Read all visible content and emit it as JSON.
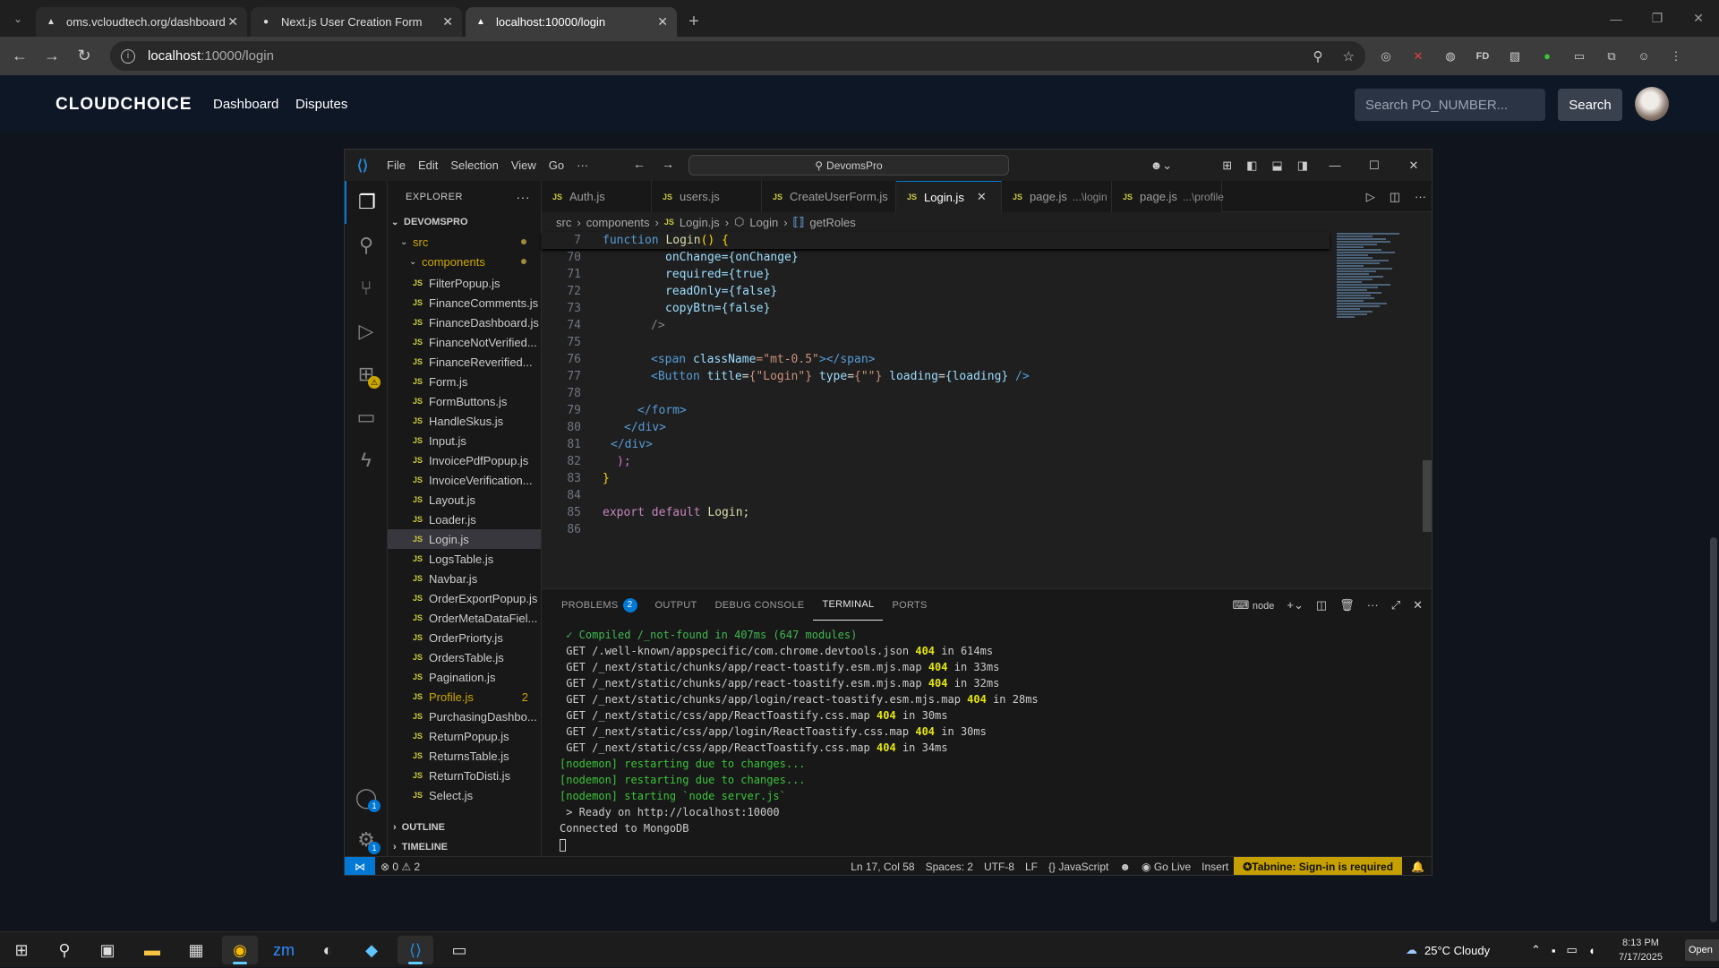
{
  "browser": {
    "tabs": [
      {
        "title": "oms.vcloudtech.org/dashboard",
        "active": false
      },
      {
        "title": "Next.js User Creation Form",
        "active": false
      },
      {
        "title": "localhost:10000/login",
        "active": true
      }
    ],
    "address": {
      "host": "localhost",
      "path": ":10000/login"
    }
  },
  "app": {
    "logo": "CLOUDCHOICE",
    "nav": [
      "Dashboard",
      "Disputes"
    ],
    "search_placeholder": "Search PO_NUMBER...",
    "search_button": "Search"
  },
  "vscode": {
    "menu": [
      "File",
      "Edit",
      "Selection",
      "View",
      "Go",
      "···"
    ],
    "command_center": "DevomsPro",
    "explorer": {
      "title": "EXPLORER",
      "project": "DEVOMSPRO",
      "folders": [
        "src",
        "components"
      ],
      "files": [
        {
          "name": "FilterPopup.js"
        },
        {
          "name": "FinanceComments.js"
        },
        {
          "name": "FinanceDashboard.js"
        },
        {
          "name": "FinanceNotVerified..."
        },
        {
          "name": "FinanceReverified..."
        },
        {
          "name": "Form.js"
        },
        {
          "name": "FormButtons.js"
        },
        {
          "name": "HandleSkus.js"
        },
        {
          "name": "Input.js"
        },
        {
          "name": "InvoicePdfPopup.js"
        },
        {
          "name": "InvoiceVerification..."
        },
        {
          "name": "Layout.js"
        },
        {
          "name": "Loader.js"
        },
        {
          "name": "Login.js",
          "selected": true
        },
        {
          "name": "LogsTable.js"
        },
        {
          "name": "Navbar.js"
        },
        {
          "name": "OrderExportPopup.js"
        },
        {
          "name": "OrderMetaDataFiel..."
        },
        {
          "name": "OrderPriorty.js"
        },
        {
          "name": "OrdersTable.js"
        },
        {
          "name": "Pagination.js"
        },
        {
          "name": "Profile.js",
          "problems": "2"
        },
        {
          "name": "PurchasingDashbo..."
        },
        {
          "name": "ReturnPopup.js"
        },
        {
          "name": "ReturnsTable.js"
        },
        {
          "name": "ReturnToDisti.js"
        },
        {
          "name": "Select.js"
        }
      ],
      "sections": [
        "OUTLINE",
        "TIMELINE"
      ]
    },
    "editor_tabs": [
      {
        "label": "Auth.js",
        "desc": ""
      },
      {
        "label": "users.js",
        "desc": ""
      },
      {
        "label": "CreateUserForm.js",
        "desc": ""
      },
      {
        "label": "Login.js",
        "desc": "",
        "active": true
      },
      {
        "label": "page.js",
        "desc": "...\\login"
      },
      {
        "label": "page.js",
        "desc": "...\\profile"
      }
    ],
    "breadcrumb": [
      "src",
      "components",
      "Login.js",
      "Login",
      "getRoles"
    ],
    "sticky_line": {
      "num": "7",
      "text": "function Login() {"
    },
    "code_lines": [
      {
        "num": "70"
      },
      {
        "num": "71"
      },
      {
        "num": "72"
      },
      {
        "num": "73"
      },
      {
        "num": "74"
      },
      {
        "num": "75"
      },
      {
        "num": "76"
      },
      {
        "num": "77"
      },
      {
        "num": "78"
      },
      {
        "num": "79"
      },
      {
        "num": "80"
      },
      {
        "num": "81"
      },
      {
        "num": "82"
      },
      {
        "num": "83"
      },
      {
        "num": "84"
      },
      {
        "num": "85"
      },
      {
        "num": "86"
      }
    ],
    "code": {
      "l70": "onChange={onChange}",
      "l71": "required={true}",
      "l72": "readOnly={false}",
      "l73": "copyBtn={false}",
      "l74": "/>",
      "l76a": "<span ",
      "l76b": "className",
      "l76c": "=\"mt-0.5\"",
      "l76d": "></span>",
      "l77a": "<Button ",
      "l77b": "title",
      "l77c": "{\"Login\"}",
      "l77d": "type",
      "l77e": "{\"\"}",
      "l77f": "loading",
      "l77g": "{loading}",
      "l77h": " />",
      "l79": "</form>",
      "l80": "</div>",
      "l81": "</div>",
      "l82": ");",
      "l83": "}",
      "l85a": "export default ",
      "l85b": "Login;"
    },
    "panel": {
      "tabs": [
        "PROBLEMS",
        "OUTPUT",
        "DEBUG CONSOLE",
        "TERMINAL",
        "PORTS"
      ],
      "problems_count": "2",
      "active_tab": "TERMINAL",
      "shell": "node"
    },
    "terminal": [
      {
        "pre": " ✓ Compiled /_not-found in 407ms (647 modules)",
        "code": "",
        "post": ""
      },
      {
        "pre": " GET /.well-known/appspecific/com.chrome.devtools.json ",
        "code": "404",
        "post": " in 614ms"
      },
      {
        "pre": " GET /_next/static/chunks/app/react-toastify.esm.mjs.map ",
        "code": "404",
        "post": " in 33ms"
      },
      {
        "pre": " GET /_next/static/chunks/app/react-toastify.esm.mjs.map ",
        "code": "404",
        "post": " in 32ms"
      },
      {
        "pre": " GET /_next/static/chunks/app/login/react-toastify.esm.mjs.map ",
        "code": "404",
        "post": " in 28ms"
      },
      {
        "pre": " GET /_next/static/css/app/ReactToastify.css.map ",
        "code": "404",
        "post": " in 30ms"
      },
      {
        "pre": " GET /_next/static/css/app/login/ReactToastify.css.map ",
        "code": "404",
        "post": " in 30ms"
      },
      {
        "pre": " GET /_next/static/css/app/ReactToastify.css.map ",
        "code": "404",
        "post": " in 34ms"
      }
    ],
    "terminal_tail": [
      {
        "text": "[nodemon] restarting due to changes...",
        "color": "green"
      },
      {
        "text": "[nodemon] restarting due to changes...",
        "color": "green"
      },
      {
        "text": "[nodemon] starting `node server.js`",
        "color": "green"
      },
      {
        "text": " > Ready on http://localhost:10000",
        "color": "plain"
      },
      {
        "text": "Connected to MongoDB",
        "color": "plain"
      }
    ],
    "status": {
      "errors": "0",
      "warnings": "2",
      "position": "Ln 17, Col 58",
      "spaces": "Spaces: 2",
      "encoding": "UTF-8",
      "eol": "LF",
      "language": "JavaScript",
      "golive": "Go Live",
      "mode": "Insert",
      "tabnine": "Tabnine: Sign-in is required"
    }
  },
  "taskbar": {
    "weather": "25°C  Cloudy",
    "time": "8:13 PM",
    "date": "7/17/2025",
    "open_label": "Open"
  },
  "colors": {
    "accent": "#0078d4",
    "tabnine": "#c6a000",
    "app_header": "#0e1726"
  }
}
